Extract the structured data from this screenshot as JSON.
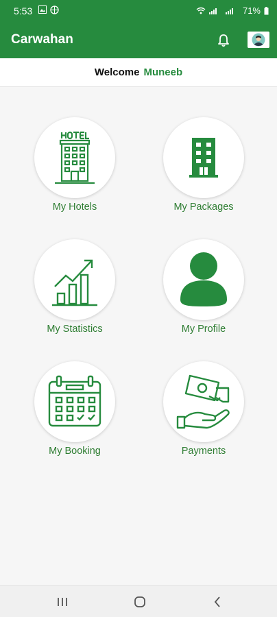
{
  "status_bar": {
    "time": "5:53",
    "battery": "71%"
  },
  "app_bar": {
    "title": "Carwahan"
  },
  "welcome": {
    "label": "Welcome",
    "name": "Muneeb"
  },
  "menu": [
    {
      "label": "My Hotels",
      "icon": "hotel-icon"
    },
    {
      "label": "My Packages",
      "icon": "building-icon"
    },
    {
      "label": "My Statistics",
      "icon": "statistics-chart-icon"
    },
    {
      "label": "My Profile",
      "icon": "profile-person-icon"
    },
    {
      "label": "My Booking",
      "icon": "calendar-icon"
    },
    {
      "label": "Payments",
      "icon": "payment-hands-icon"
    }
  ],
  "colors": {
    "primary": "#268b3e",
    "label": "#2e7d32",
    "background": "#f6f6f6"
  }
}
